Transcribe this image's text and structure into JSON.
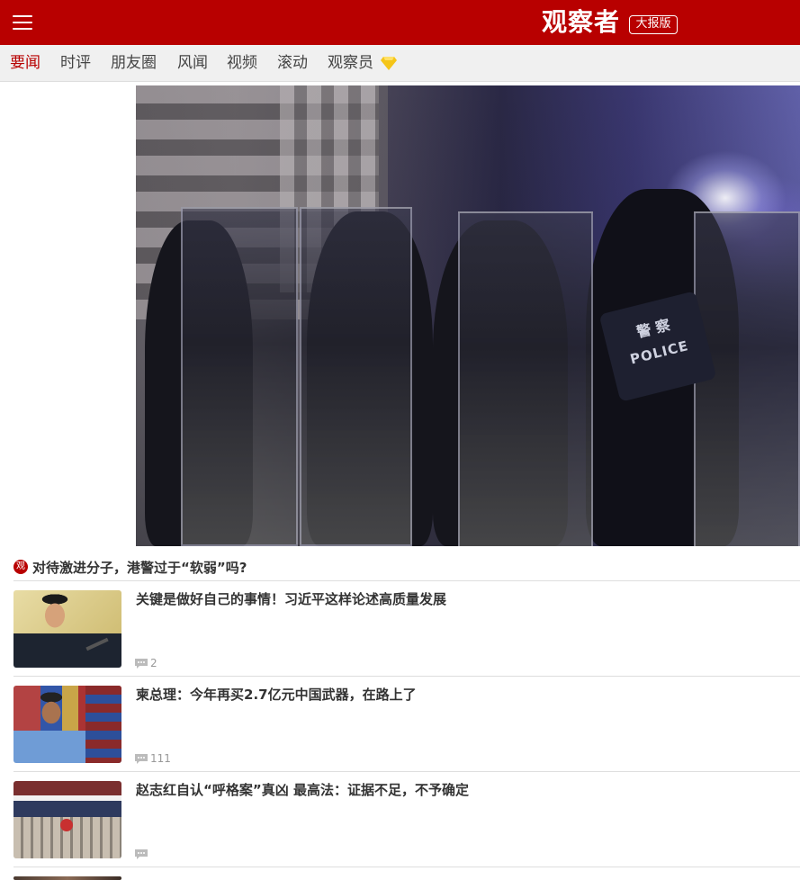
{
  "header": {
    "logo": "观察者",
    "edition_button": "大报版"
  },
  "nav": {
    "items": [
      {
        "label": "要闻",
        "active": true
      },
      {
        "label": "时评",
        "active": false
      },
      {
        "label": "朋友圈",
        "active": false
      },
      {
        "label": "风闻",
        "active": false
      },
      {
        "label": "视频",
        "active": false
      },
      {
        "label": "滚动",
        "active": false
      },
      {
        "label": "观察员",
        "active": false
      }
    ]
  },
  "hero": {
    "patch_line1": "警 察",
    "patch_line2": "POLICE"
  },
  "lead": {
    "badge": "观",
    "title": "对待激进分子，港警过于“软弱”吗?"
  },
  "articles": [
    {
      "title": "关键是做好自己的事情！习近平这样论述高质量发展",
      "comments": "2"
    },
    {
      "title": "柬总理：今年再买2.7亿元中国武器，在路上了",
      "comments": "111"
    },
    {
      "title": "赵志红自认“呼格案”真凶 最高法：证据不足，不予确定",
      "comments": ""
    }
  ],
  "colors": {
    "brand_red": "#b80000",
    "nav_bg": "#f0f0f0",
    "gem_yellow": "#f5c518"
  }
}
